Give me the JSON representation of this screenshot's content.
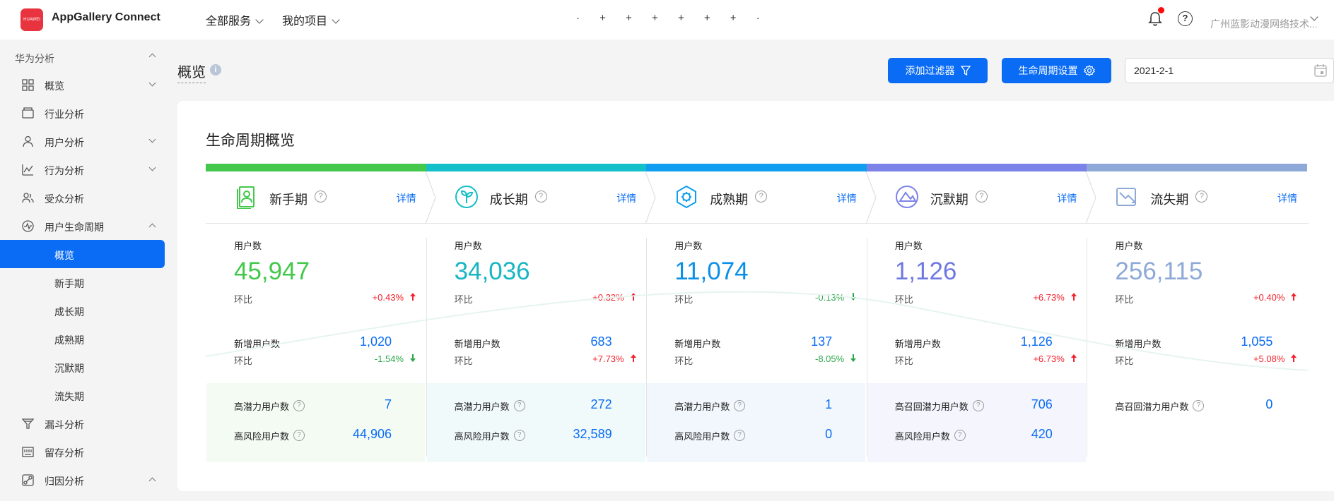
{
  "header": {
    "logo_text": "HUAWEI",
    "app_title": "AppGallery Connect",
    "menu_all_services": "全部服务",
    "menu_my_projects": "我的项目",
    "placeholder_center": "· + + + + + + ·",
    "user_name": "广州蓝影动漫网络技术..."
  },
  "sidebar": {
    "section_title": "华为分析",
    "items": [
      {
        "label": "概览",
        "icon": "grid-icon",
        "chevron": "down"
      },
      {
        "label": "行业分析",
        "icon": "industry-icon",
        "chevron": ""
      },
      {
        "label": "用户分析",
        "icon": "user-icon",
        "chevron": "down"
      },
      {
        "label": "行为分析",
        "icon": "behavior-icon",
        "chevron": "down"
      },
      {
        "label": "受众分析",
        "icon": "audience-icon",
        "chevron": ""
      },
      {
        "label": "用户生命周期",
        "icon": "lifecycle-icon",
        "chevron": "up"
      }
    ],
    "sub_items": [
      "概览",
      "新手期",
      "成长期",
      "成熟期",
      "沉默期",
      "流失期"
    ],
    "items_after": [
      {
        "label": "漏斗分析",
        "icon": "funnel-icon",
        "chevron": ""
      },
      {
        "label": "留存分析",
        "icon": "retention-icon",
        "chevron": ""
      },
      {
        "label": "归因分析",
        "icon": "attribution-icon",
        "chevron": "up"
      }
    ]
  },
  "toolbar": {
    "page_title": "概览",
    "add_filter": "添加过滤器",
    "lifecycle_settings": "生命周期设置",
    "date_value": "2021-2-1"
  },
  "card": {
    "title": "生命周期概览",
    "detail_label": "详情",
    "user_count_label": "用户数",
    "ratio_label": "环比",
    "new_users_label": "新增用户数"
  },
  "stages": [
    {
      "name": "新手期",
      "color": "#43c84b",
      "num_color": "#43c84b",
      "users": "45,947",
      "users_ratio": "+0.43%",
      "users_dir": "up",
      "new_users": "1,020",
      "new_ratio": "-1.54%",
      "new_dir": "down",
      "r1_label": "高潜力用户数",
      "r1_value": "7",
      "r2_label": "高风险用户数",
      "r2_value": "44,906",
      "band": "#f3fbf3"
    },
    {
      "name": "成长期",
      "color": "#13bfc8",
      "num_color": "#18b5c3",
      "users": "34,036",
      "users_ratio": "+0.32%",
      "users_dir": "up",
      "new_users": "683",
      "new_ratio": "+7.73%",
      "new_dir": "up",
      "r1_label": "高潜力用户数",
      "r1_value": "272",
      "r2_label": "高风险用户数",
      "r2_value": "32,589",
      "band": "#f1fafb"
    },
    {
      "name": "成熟期",
      "color": "#0f9ef0",
      "num_color": "#0a8fe8",
      "users": "11,074",
      "users_ratio": "-0.13%",
      "users_dir": "down",
      "new_users": "137",
      "new_ratio": "-8.05%",
      "new_dir": "down",
      "r1_label": "高潜力用户数",
      "r1_value": "1",
      "r2_label": "高风险用户数",
      "r2_value": "0",
      "band": "#f1f7fc"
    },
    {
      "name": "沉默期",
      "color": "#7c83e8",
      "num_color": "#6e78e3",
      "users": "1,126",
      "users_ratio": "+6.73%",
      "users_dir": "up",
      "new_users": "1,126",
      "new_ratio": "+6.73%",
      "new_dir": "up",
      "r1_label": "高召回潜力用户数",
      "r1_value": "706",
      "r2_label": "高风险用户数",
      "r2_value": "420",
      "band": "#f4f5fd"
    },
    {
      "name": "流失期",
      "color": "#8ea9d8",
      "num_color": "#8ea9d8",
      "users": "256,115",
      "users_ratio": "+0.40%",
      "users_dir": "up",
      "new_users": "1,055",
      "new_ratio": "+5.08%",
      "new_dir": "up",
      "r1_label": "高召回潜力用户数",
      "r1_value": "0",
      "r2_label": "",
      "r2_value": "",
      "band": "#ffffff"
    }
  ],
  "colors": {
    "accent": "#0a6cf5",
    "up": "#f5222d",
    "down": "#2ba84a"
  }
}
